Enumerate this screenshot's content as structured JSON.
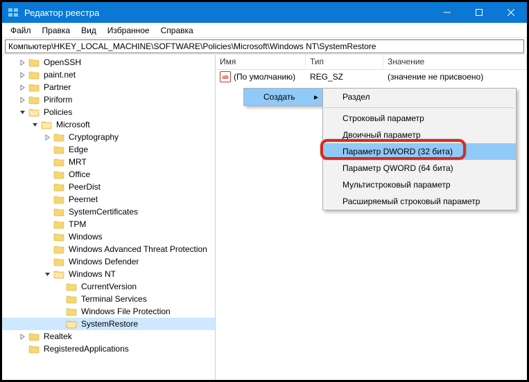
{
  "title": "Редактор реестра",
  "menu": [
    "Файл",
    "Правка",
    "Вид",
    "Избранное",
    "Справка"
  ],
  "address": "Компьютер\\HKEY_LOCAL_MACHINE\\SOFTWARE\\Policies\\Microsoft\\Windows NT\\SystemRestore",
  "columns": {
    "name": "Имя",
    "type": "Тип",
    "value": "Значение"
  },
  "default_row": {
    "name": "(По умолчанию)",
    "type": "REG_SZ",
    "value": "(значение не присвоено)"
  },
  "ctx_primary": {
    "create": "Создать"
  },
  "ctx_secondary": [
    "Раздел",
    "Строковый параметр",
    "Двоичный параметр",
    "Параметр DWORD (32 бита)",
    "Параметр QWORD (64 бита)",
    "Мультистроковый параметр",
    "Расширяемый строковый параметр"
  ],
  "tree": {
    "items": [
      "OpenSSH",
      "paint.net",
      "Partner",
      "Piriform",
      "Policies",
      "Realtek",
      "RegisteredApplications"
    ],
    "policies_children": [
      "Microsoft"
    ],
    "microsoft_children": [
      "Cryptography",
      "Edge",
      "MRT",
      "Office",
      "PeerDist",
      "Peernet",
      "SystemCertificates",
      "TPM",
      "Windows",
      "Windows Advanced Threat Protection",
      "Windows Defender",
      "Windows NT"
    ],
    "windowsnt_children": [
      "CurrentVersion",
      "Terminal Services",
      "Windows File Protection",
      "SystemRestore"
    ]
  }
}
